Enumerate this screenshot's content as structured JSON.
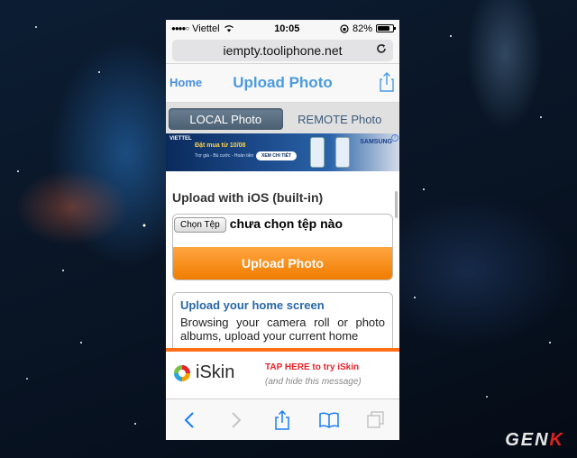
{
  "status_bar": {
    "carrier": "Viettel",
    "time": "10:05",
    "battery": "82%",
    "battery_fraction": 0.82
  },
  "browser": {
    "url": "iempty.tooliphone.net"
  },
  "navbar": {
    "home": "Home",
    "title": "Upload Photo"
  },
  "tabs": {
    "local": "LOCAL Photo",
    "remote": "REMOTE Photo"
  },
  "ad": {
    "brand": "VIETTEL",
    "headline": "Đặt mua từ 10/08",
    "subline": "Trợ giá - Bù cước - Hoàn tiền",
    "button": "XEM CHI TIẾT",
    "partner": "SAMSUNG"
  },
  "upload_section": {
    "title": "Upload with iOS (built-in)",
    "choose_file_label": "Chọn Tệp",
    "file_status": "chưa chọn tệp nào",
    "upload_button": "Upload Photo"
  },
  "home_screen_card": {
    "title": "Upload your home screen",
    "text": "Browsing your camera roll or photo albums, upload your current home"
  },
  "iskin_banner": {
    "name": "iSkin",
    "cta": "TAP HERE to try iSkin",
    "sub": "(and hide this message)"
  },
  "toolbar": {
    "items": [
      "back-icon",
      "forward-icon",
      "share-icon",
      "bookmarks-icon",
      "tabs-icon"
    ]
  },
  "watermark": {
    "prefix": "GEN",
    "suffix": "K"
  },
  "colors": {
    "accent_blue": "#4a9be0",
    "upload_orange": "#f07c00",
    "iskin_red": "#e8222a"
  }
}
